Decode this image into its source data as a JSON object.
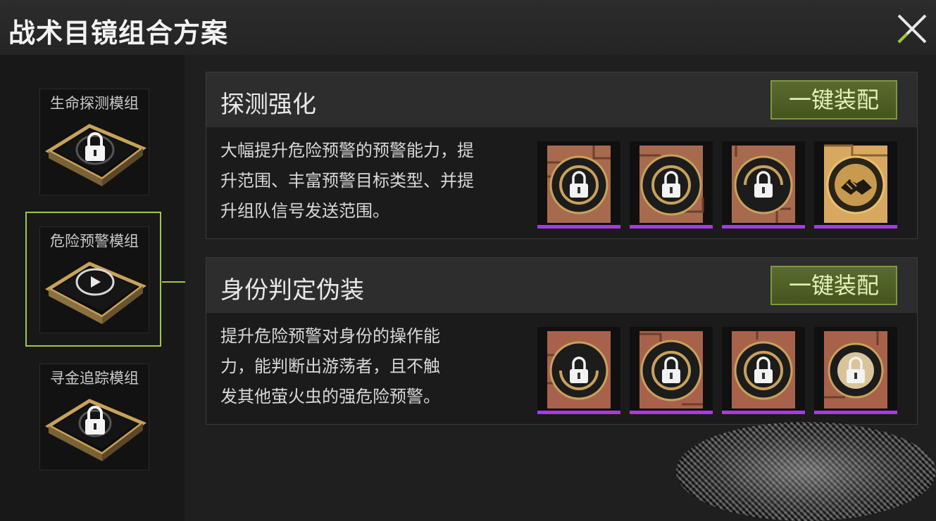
{
  "header": {
    "title": "战术目镜组合方案"
  },
  "sidebar": {
    "modules": [
      {
        "label": "生命探测模组",
        "selected": false,
        "locked": true
      },
      {
        "label": "危险预警模组",
        "selected": true,
        "locked": false
      },
      {
        "label": "寻金追踪模组",
        "selected": false,
        "locked": true
      }
    ]
  },
  "schemes": [
    {
      "title": "探测强化",
      "equip_label": "一键装配",
      "description": "大幅提升危险预警的预警能力，提升范围、丰富预警目标类型、并提升组队信号发送范围。",
      "desc_lines": [
        "大幅提升危险预警的预警能力，提",
        "升范围、丰富预警目标类型、并提",
        "升组队信号发送范围。"
      ],
      "slots": [
        {
          "icon": "lock-icon",
          "rarity_color": "#a23ee0"
        },
        {
          "icon": "lock-icon",
          "rarity_color": "#a23ee0"
        },
        {
          "icon": "lock-icon",
          "rarity_color": "#a23ee0"
        },
        {
          "icon": "handshake-icon",
          "rarity_color": "#a23ee0"
        }
      ]
    },
    {
      "title": "身份判定伪装",
      "equip_label": "一键装配",
      "description": "提升危险预警对身份的操作能力，能判断出游荡者，且不触发其他萤火虫的强危险预警。",
      "desc_lines": [
        "提升危险预警对身份的操作能",
        "力，能判断出游荡者，且不触",
        "发其他萤火虫的强危险预警。"
      ],
      "slots": [
        {
          "icon": "lock-icon",
          "rarity_color": "#a23ee0"
        },
        {
          "icon": "lock-icon",
          "rarity_color": "#a23ee0"
        },
        {
          "icon": "lock-icon",
          "rarity_color": "#a23ee0"
        },
        {
          "icon": "lock-icon",
          "rarity_color": "#a23ee0"
        }
      ]
    }
  ],
  "colors": {
    "accent_green": "#9fc93c",
    "equip_button": "#4f5f26",
    "rarity_purple": "#a23ee0",
    "chip_gold": "#c8a25a",
    "card_copper": "#a86a4e"
  }
}
